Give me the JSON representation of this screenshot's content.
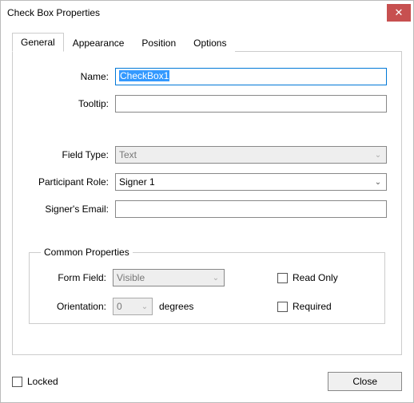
{
  "window": {
    "title": "Check Box Properties"
  },
  "tabs": {
    "general": "General",
    "appearance": "Appearance",
    "position": "Position",
    "options": "Options"
  },
  "fields": {
    "name_label": "Name:",
    "name_value": "CheckBox1",
    "tooltip_label": "Tooltip:",
    "tooltip_value": "",
    "field_type_label": "Field Type:",
    "field_type_value": "Text",
    "participant_role_label": "Participant Role:",
    "participant_role_value": "Signer 1",
    "signers_email_label": "Signer's Email:",
    "signers_email_value": ""
  },
  "common": {
    "legend": "Common Properties",
    "form_field_label": "Form Field:",
    "form_field_value": "Visible",
    "orientation_label": "Orientation:",
    "orientation_value": "0",
    "degrees_label": "degrees",
    "read_only_label": "Read Only",
    "required_label": "Required"
  },
  "footer": {
    "locked_label": "Locked",
    "close_label": "Close"
  }
}
